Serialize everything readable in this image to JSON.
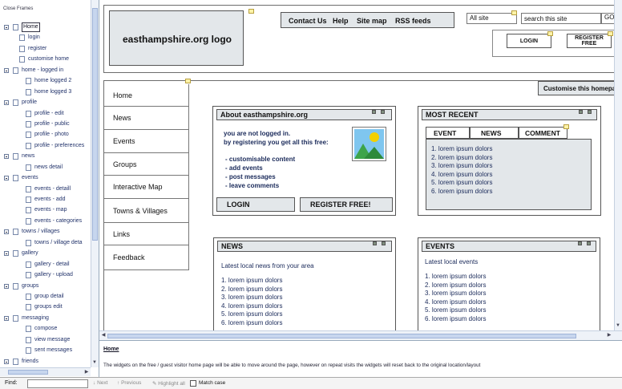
{
  "tree": {
    "close_frames": "Close Frames",
    "items": [
      {
        "label": "Home",
        "level": 0,
        "selected": true
      },
      {
        "label": "login",
        "level": 1
      },
      {
        "label": "register",
        "level": 1
      },
      {
        "label": "customise home",
        "level": 1
      },
      {
        "label": "home - logged in",
        "level": 0
      },
      {
        "label": "home logged 2",
        "level": 2
      },
      {
        "label": "home logged 3",
        "level": 2
      },
      {
        "label": "profile",
        "level": 0
      },
      {
        "label": "profile - edit",
        "level": 2
      },
      {
        "label": "profile - public",
        "level": 2
      },
      {
        "label": "profile - photo",
        "level": 2
      },
      {
        "label": "profile - preferences",
        "level": 2
      },
      {
        "label": "news",
        "level": 0
      },
      {
        "label": "news detail",
        "level": 2
      },
      {
        "label": "events",
        "level": 0
      },
      {
        "label": "events - detaill",
        "level": 2
      },
      {
        "label": "events - add",
        "level": 2
      },
      {
        "label": "events - map",
        "level": 2
      },
      {
        "label": "events - categories",
        "level": 2
      },
      {
        "label": "towns / villages",
        "level": 0
      },
      {
        "label": "towns / village deta",
        "level": 2
      },
      {
        "label": "gallery",
        "level": 0
      },
      {
        "label": "gallery - detail",
        "level": 2
      },
      {
        "label": "gallery - upload",
        "level": 2
      },
      {
        "label": "groups",
        "level": 0
      },
      {
        "label": "group detail",
        "level": 2
      },
      {
        "label": "groups edit",
        "level": 2
      },
      {
        "label": "messaging",
        "level": 0
      },
      {
        "label": "compose",
        "level": 2
      },
      {
        "label": "view message",
        "level": 2
      },
      {
        "label": "sent messages",
        "level": 2
      },
      {
        "label": "friends",
        "level": 0
      }
    ]
  },
  "header": {
    "logo": "easthampshire.org logo",
    "links": [
      "Contact Us",
      "Help",
      "Site map",
      "RSS feeds"
    ],
    "site_select": "All site",
    "search_value": "search this site",
    "go": "GO",
    "login": "LOGIN",
    "register_line1": "REGISTER",
    "register_line2": "FREE"
  },
  "customise": "Customise this homepa",
  "nav": [
    "Home",
    "News",
    "Events",
    "Groups",
    "Interactive Map",
    "Towns & Villages",
    "Links",
    "Feedback"
  ],
  "about": {
    "title": "About easthampshire.org",
    "intro1": "you are not logged in.",
    "intro2": "by registering you get all this free:",
    "bullets": [
      "- customisable content",
      "- add events",
      "- post messages",
      "- leave comments"
    ],
    "login": "LOGIN",
    "register": "REGISTER FREE!"
  },
  "recent": {
    "title": "MOST RECENT",
    "tabs": [
      "EVENT",
      "NEWS",
      "COMMENT"
    ],
    "items": [
      "1. lorem ipsum dolors",
      "2. lorem ipsum dolors",
      "3. lorem ipsum dolors",
      "4. lorem ipsum dolors",
      "5. lorem ipsum dolors",
      "6. lorem ipsum dolors"
    ]
  },
  "news": {
    "title": "NEWS",
    "subtitle": "Latest local news from your area",
    "items": [
      "1. lorem ipsum dolors",
      "2. lorem ipsum dolors",
      "3. lorem ipsum dolors",
      "4. lorem ipsum dolors",
      "5. lorem ipsum dolors",
      "6. lorem ipsum dolors"
    ]
  },
  "events": {
    "title": "EVENTS",
    "subtitle": "Latest local events",
    "items": [
      "1. lorem ipsum dolors",
      "2. lorem ipsum dolors",
      "3. lorem ipsum dolors",
      "4. lorem ipsum dolors",
      "5. lorem ipsum dolors",
      "6. lorem ipsum dolors"
    ]
  },
  "status": {
    "title": "Home",
    "text": "The widgets on the free / guest visitor home page will be able to move around the page, however on repeat visits the widgets will reset back to the original location/layout"
  },
  "find": {
    "label": "Find:",
    "next": "Next",
    "previous": "Previous",
    "highlight": "Highlight all",
    "match_case": "Match case"
  },
  "colors": {
    "box_fill": "#e3e7ea",
    "note_fill": "#fff3a8",
    "text_blue": "#1a2a5a"
  }
}
